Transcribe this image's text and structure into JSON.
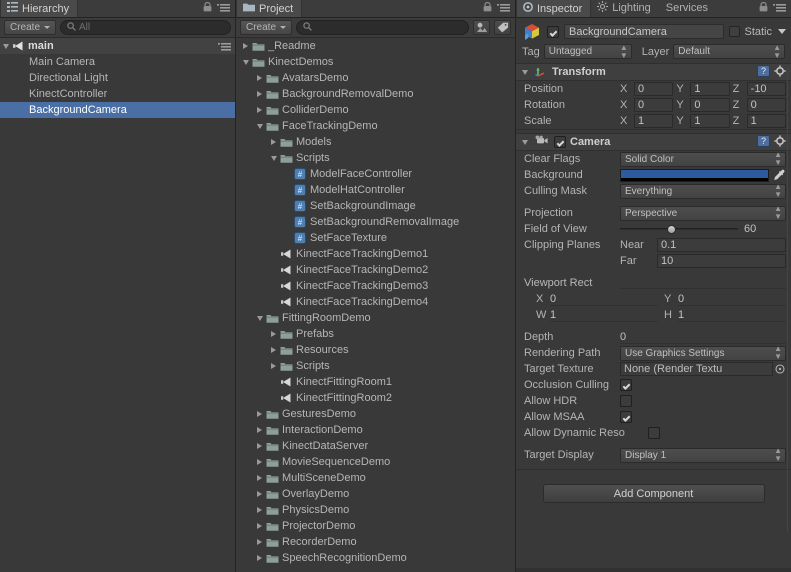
{
  "hierarchy": {
    "tab_label": "Hierarchy",
    "create_label": "Create",
    "search_placeholder": "All",
    "scene_name": "main",
    "items": [
      {
        "label": "Main Camera",
        "selected": false
      },
      {
        "label": "Directional Light",
        "selected": false
      },
      {
        "label": "KinectController",
        "selected": false
      },
      {
        "label": "BackgroundCamera",
        "selected": true
      }
    ]
  },
  "project": {
    "tab_label": "Project",
    "create_label": "Create",
    "search_placeholder": "",
    "items": [
      {
        "label": "_Readme",
        "indent": 0,
        "type": "folder",
        "state": "closed"
      },
      {
        "label": "KinectDemos",
        "indent": 0,
        "type": "folder",
        "state": "open"
      },
      {
        "label": "AvatarsDemo",
        "indent": 1,
        "type": "folder",
        "state": "closed"
      },
      {
        "label": "BackgroundRemovalDemo",
        "indent": 1,
        "type": "folder",
        "state": "closed"
      },
      {
        "label": "ColliderDemo",
        "indent": 1,
        "type": "folder",
        "state": "closed"
      },
      {
        "label": "FaceTrackingDemo",
        "indent": 1,
        "type": "folder",
        "state": "open"
      },
      {
        "label": "Models",
        "indent": 2,
        "type": "folder",
        "state": "closed"
      },
      {
        "label": "Scripts",
        "indent": 2,
        "type": "folder",
        "state": "open"
      },
      {
        "label": "ModelFaceController",
        "indent": 3,
        "type": "script",
        "state": "leaf"
      },
      {
        "label": "ModelHatController",
        "indent": 3,
        "type": "script",
        "state": "leaf"
      },
      {
        "label": "SetBackgroundImage",
        "indent": 3,
        "type": "script",
        "state": "leaf"
      },
      {
        "label": "SetBackgroundRemovalImage",
        "indent": 3,
        "type": "script",
        "state": "leaf"
      },
      {
        "label": "SetFaceTexture",
        "indent": 3,
        "type": "script",
        "state": "leaf"
      },
      {
        "label": "KinectFaceTrackingDemo1",
        "indent": 2,
        "type": "scene",
        "state": "leaf"
      },
      {
        "label": "KinectFaceTrackingDemo2",
        "indent": 2,
        "type": "scene",
        "state": "leaf"
      },
      {
        "label": "KinectFaceTrackingDemo3",
        "indent": 2,
        "type": "scene",
        "state": "leaf"
      },
      {
        "label": "KinectFaceTrackingDemo4",
        "indent": 2,
        "type": "scene",
        "state": "leaf"
      },
      {
        "label": "FittingRoomDemo",
        "indent": 1,
        "type": "folder",
        "state": "open"
      },
      {
        "label": "Prefabs",
        "indent": 2,
        "type": "folder",
        "state": "closed"
      },
      {
        "label": "Resources",
        "indent": 2,
        "type": "folder",
        "state": "closed"
      },
      {
        "label": "Scripts",
        "indent": 2,
        "type": "folder",
        "state": "closed"
      },
      {
        "label": "KinectFittingRoom1",
        "indent": 2,
        "type": "scene",
        "state": "leaf"
      },
      {
        "label": "KinectFittingRoom2",
        "indent": 2,
        "type": "scene",
        "state": "leaf"
      },
      {
        "label": "GesturesDemo",
        "indent": 1,
        "type": "folder",
        "state": "closed"
      },
      {
        "label": "InteractionDemo",
        "indent": 1,
        "type": "folder",
        "state": "closed"
      },
      {
        "label": "KinectDataServer",
        "indent": 1,
        "type": "folder",
        "state": "closed"
      },
      {
        "label": "MovieSequenceDemo",
        "indent": 1,
        "type": "folder",
        "state": "closed"
      },
      {
        "label": "MultiSceneDemo",
        "indent": 1,
        "type": "folder",
        "state": "closed"
      },
      {
        "label": "OverlayDemo",
        "indent": 1,
        "type": "folder",
        "state": "closed"
      },
      {
        "label": "PhysicsDemo",
        "indent": 1,
        "type": "folder",
        "state": "closed"
      },
      {
        "label": "ProjectorDemo",
        "indent": 1,
        "type": "folder",
        "state": "closed"
      },
      {
        "label": "RecorderDemo",
        "indent": 1,
        "type": "folder",
        "state": "closed"
      },
      {
        "label": "SpeechRecognitionDemo",
        "indent": 1,
        "type": "folder",
        "state": "closed"
      }
    ]
  },
  "inspector": {
    "tabs": [
      {
        "label": "Inspector",
        "active": true
      },
      {
        "label": "Lighting",
        "active": false
      },
      {
        "label": "Services",
        "active": false
      }
    ],
    "object": {
      "name": "BackgroundCamera",
      "enabled": true,
      "static_label": "Static",
      "tag_label": "Tag",
      "tag_value": "Untagged",
      "layer_label": "Layer",
      "layer_value": "Default"
    },
    "transform": {
      "title": "Transform",
      "rows": [
        {
          "label": "Position",
          "x": "0",
          "y": "1",
          "z": "-10"
        },
        {
          "label": "Rotation",
          "x": "0",
          "y": "0",
          "z": "0"
        },
        {
          "label": "Scale",
          "x": "1",
          "y": "1",
          "z": "1"
        }
      ],
      "axis_labels": {
        "x": "X",
        "y": "Y",
        "z": "Z"
      }
    },
    "camera": {
      "title": "Camera",
      "enabled": true,
      "clear_flags_label": "Clear Flags",
      "clear_flags_value": "Solid Color",
      "background_label": "Background",
      "background_color": "#2d5b9e",
      "culling_mask_label": "Culling Mask",
      "culling_mask_value": "Everything",
      "projection_label": "Projection",
      "projection_value": "Perspective",
      "fov_label": "Field of View",
      "fov_value": "60",
      "clipping_label": "Clipping Planes",
      "near_label": "Near",
      "near_value": "0.1",
      "far_label": "Far",
      "far_value": "10",
      "viewport_label": "Viewport Rect",
      "viewport": {
        "x_label": "X",
        "x_value": "0",
        "y_label": "Y",
        "y_value": "0",
        "w_label": "W",
        "w_value": "1",
        "h_label": "H",
        "h_value": "1"
      },
      "depth_label": "Depth",
      "depth_value": "0",
      "rendering_path_label": "Rendering Path",
      "rendering_path_value": "Use Graphics Settings",
      "target_texture_label": "Target Texture",
      "target_texture_value": "None (Render Textu",
      "occlusion_label": "Occlusion Culling",
      "occlusion_checked": true,
      "hdr_label": "Allow HDR",
      "hdr_checked": false,
      "msaa_label": "Allow MSAA",
      "msaa_checked": true,
      "dynres_label": "Allow Dynamic Reso",
      "dynres_checked": false,
      "target_display_label": "Target Display",
      "target_display_value": "Display 1"
    },
    "add_component_label": "Add Component"
  }
}
